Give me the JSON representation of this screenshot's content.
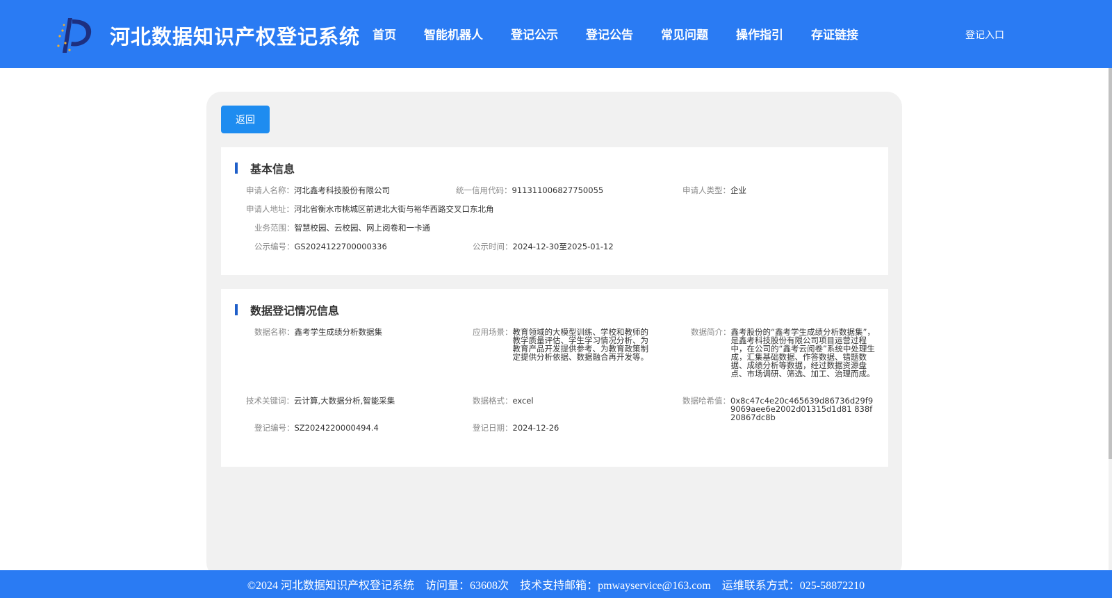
{
  "header": {
    "title": "河北数据知识产权登记系统",
    "nav": [
      "首页",
      "智能机器人",
      "登记公示",
      "登记公告",
      "常见问题",
      "操作指引",
      "存证链接"
    ],
    "login": "登记入口",
    "accent": "#2a7bf3"
  },
  "back_button": "返回",
  "basic_info": {
    "title": "基本信息",
    "applicant_name_label": "申请人名称：",
    "applicant_name": "河北鑫考科技股份有限公司",
    "credit_code_label": "统一信用代码：",
    "credit_code": "91131100682775005​5",
    "applicant_type_label": "申请人类型：",
    "applicant_type": "企业",
    "address_label": "申请人地址：",
    "address": "河北省衡水市桃城区前进北大街与裕华西路交叉口东北角",
    "business_scope_label": "业务范围：",
    "business_scope": "智慧校园、云校园、网上阅卷和一卡通",
    "notice_no_label": "公示编号：",
    "notice_no": "GS2024122700000336",
    "notice_time_label": "公示时间：",
    "notice_time": "2024-12-30至2025-01-12"
  },
  "data_info": {
    "title": "数据登记情况信息",
    "data_name_label": "数据名称：",
    "data_name": "鑫考学生成绩分析数据集",
    "scenario_label": "应用场景：",
    "scenario": "教育领域的大模型训练、学校和教师的教学质量评估、学生学习情况分析、为教育产品开发提供参考、为教育政策制定提供分析依据、数据融合再开发等。",
    "intro_label": "数据简介：",
    "intro": "鑫考股份的“鑫考学生成绩分析数据集”，是鑫考科技股份有限公司项目运营过程中，在公司的“鑫考云阅卷”系统中处理生成，汇集基础数据、作答数据、错题数据、成绩分析等数据，经过数据资源盘点、市场调研、筛选、加工、治理而成。",
    "keywords_label": "技术关键词：",
    "keywords": "云计算,大数据分析,智能采集",
    "format_label": "数据格式：",
    "format": "excel",
    "hash_label": "数据哈希值：",
    "hash": "0x8c47c4e20c465639d86736d29f99069aee6e2002d01315d1d81 838f20867dc8b",
    "reg_no_label": "登记编号：",
    "reg_no": "SZ2024220000494.4",
    "reg_date_label": "登记日期：",
    "reg_date": "2024-12-26"
  },
  "footer": {
    "copyright": "©2024 河北数据知识产权登记系统",
    "visits": "访问量：63608次",
    "email": "技术支持邮箱：pmwayservice@163.com",
    "phone": "运维联系方式：025-58872210"
  }
}
